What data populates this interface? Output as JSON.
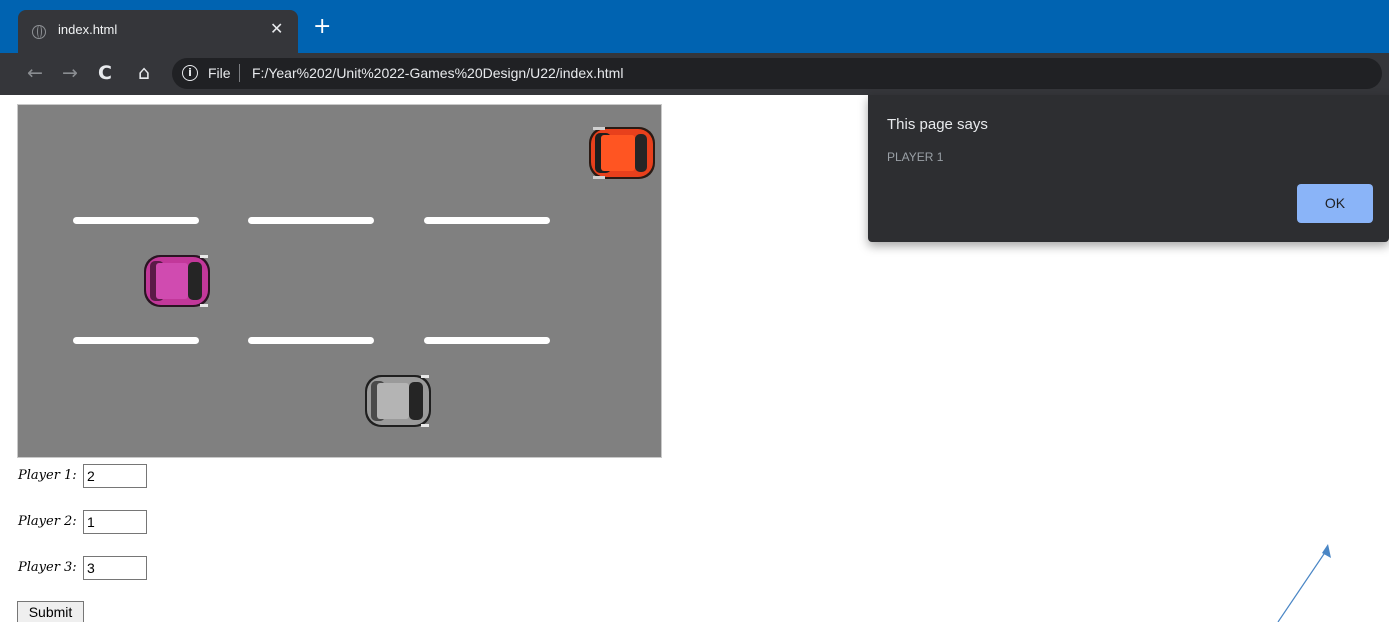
{
  "browser": {
    "tab_title": "index.html",
    "tab_close": "✕",
    "new_tab": "+",
    "back": "←",
    "forward": "→",
    "reload": "C",
    "home": "⌂",
    "info": "i",
    "scheme_label": "File",
    "url": "F:/Year%202/Unit%2022-Games%20Design/U22/index.html"
  },
  "game": {
    "background_color": "#808080",
    "lane_color": "#ffffff",
    "cars": [
      {
        "name": "red-car",
        "color": "#e8401c"
      },
      {
        "name": "pink-car",
        "color": "#c2389a"
      },
      {
        "name": "grey-car",
        "color": "#9a9a9a"
      }
    ]
  },
  "form": {
    "fields": [
      {
        "label": "Player 1:",
        "value": "2"
      },
      {
        "label": "Player 2:",
        "value": "1"
      },
      {
        "label": "Player 3:",
        "value": "3"
      }
    ],
    "submit_label": "Submit"
  },
  "alert": {
    "title": "This page says",
    "message": "PLAYER 1",
    "ok_label": "OK"
  }
}
